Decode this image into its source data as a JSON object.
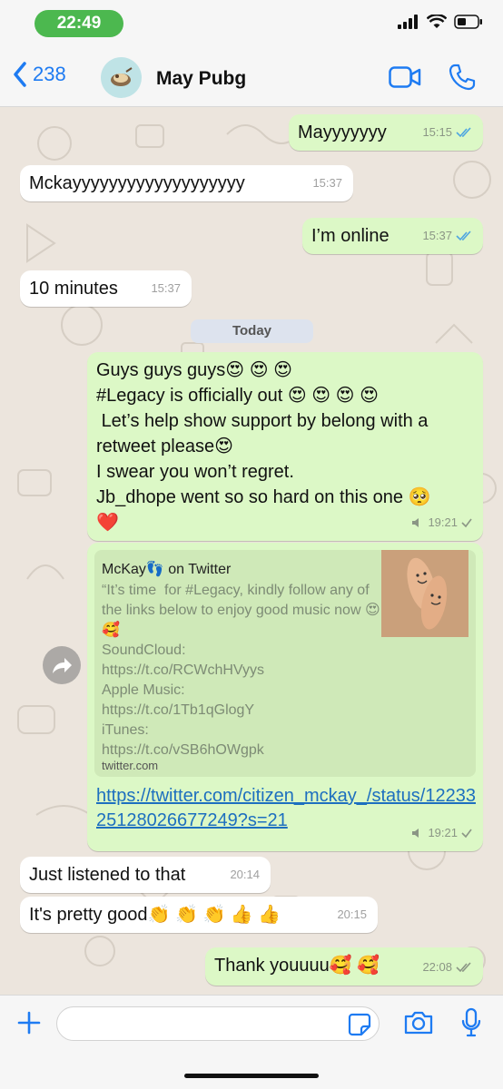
{
  "status_bar": {
    "time": "22:49"
  },
  "header": {
    "back_count": "238",
    "contact_name": "May Pubg"
  },
  "date_separator": "Today",
  "messages": [
    {
      "text": "Mayyyyyyy",
      "time": "15:15",
      "direction": "out"
    },
    {
      "text": "Mckayyyyyyyyyyyyyyyyyyy",
      "time": "15:37",
      "direction": "in"
    },
    {
      "text": "I’m online",
      "time": "15:37",
      "direction": "out"
    },
    {
      "text": "10 minutes",
      "time": "15:37",
      "direction": "in"
    },
    {
      "text": "Guys guys guys😍 😍 😍\n#Legacy is officially out 😍 😍 😍 😍\n Let’s help show support by belong with a retweet please😍\nI swear you won’t regret.\nJb_dhope went so so hard on this one 🥺\n❤️",
      "time": "19:21",
      "direction": "out"
    },
    {
      "text": "Just listened to that",
      "time": "20:14",
      "direction": "in"
    },
    {
      "text": "It's pretty good👏 👏 👏 👍 👍",
      "time": "20:15",
      "direction": "in"
    },
    {
      "text": "Thank youuuu🥰 🥰",
      "time": "22:08",
      "direction": "out"
    }
  ],
  "link_message": {
    "card_title": "McKay👣 on Twitter",
    "card_description": "“It’s time  for #Legacy, kindly follow any of the links below to enjoy good music now 😍🥰\nSoundCloud:\nhttps://t.co/RCWchHVyys\nApple Music:\nhttps://t.co/1Tb1qGlogY\niTunes:\nhttps://t.co/vSB6hOWgpk",
    "card_domain": "twitter.com",
    "url": "https://twitter.com/citizen_mckay_/status/1223325128026677249?s=21",
    "time": "19:21"
  },
  "input": {
    "placeholder": ""
  },
  "colors": {
    "outgoing": "#dcf8c6",
    "incoming": "#ffffff",
    "accent": "#1e7bf2",
    "status_pill": "#4cb84f",
    "read_ticks": "#4fa6e0"
  },
  "icons": [
    "back-chevron-icon",
    "video-call-icon",
    "phone-icon",
    "share-forward-icon",
    "plus-icon",
    "sticker-icon",
    "camera-icon",
    "microphone-icon",
    "double-check-icon",
    "speaker-icon"
  ]
}
